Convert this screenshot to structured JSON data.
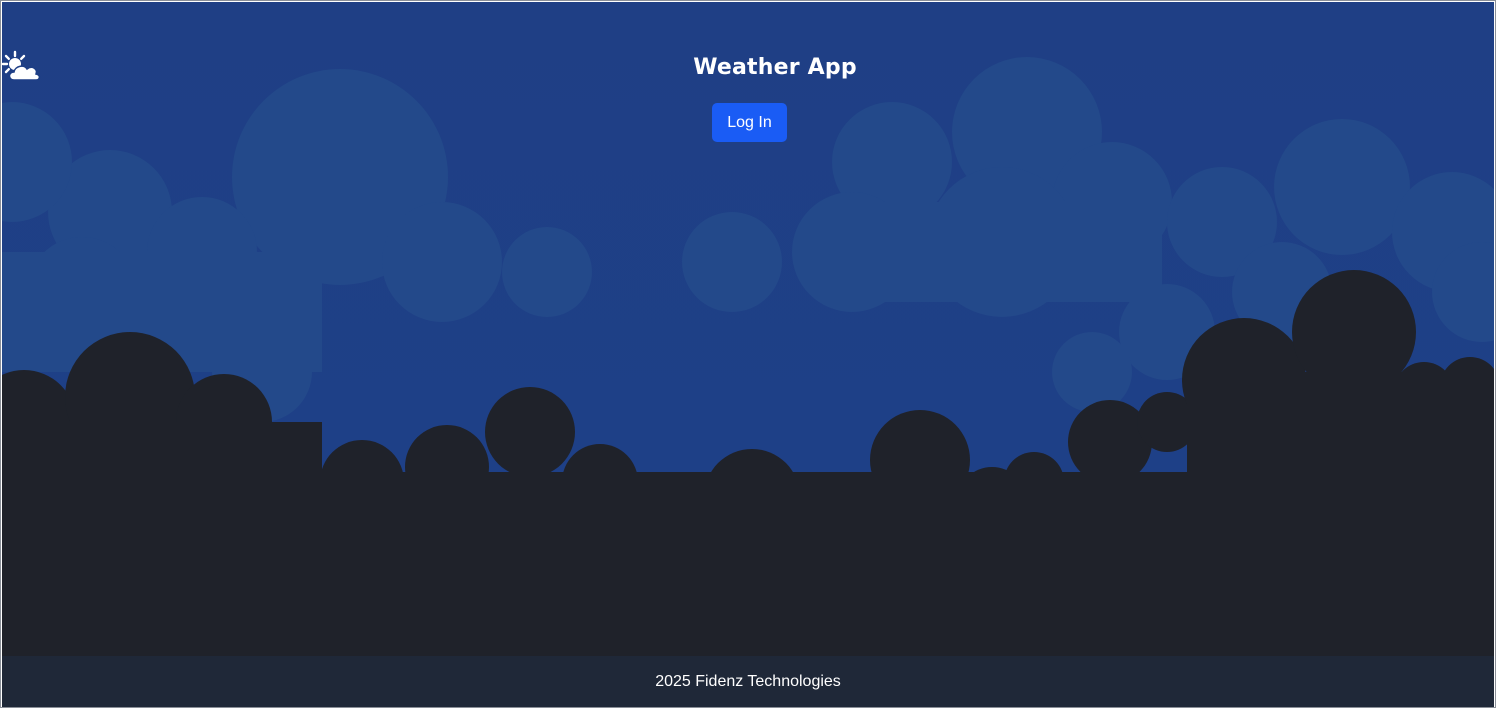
{
  "app": {
    "title": "Weather App",
    "icon": "sun-behind-cloud-icon"
  },
  "header": {
    "login_label": "Log In"
  },
  "footer": {
    "copyright": "2025 Fidenz Technologies"
  },
  "colors": {
    "sky": "#1e3f86",
    "light_clouds": "#244a8a",
    "dark_clouds": "#1f222a",
    "footer_bg": "#1f2838",
    "button": "#1a5cf5",
    "text": "#ffffff"
  }
}
